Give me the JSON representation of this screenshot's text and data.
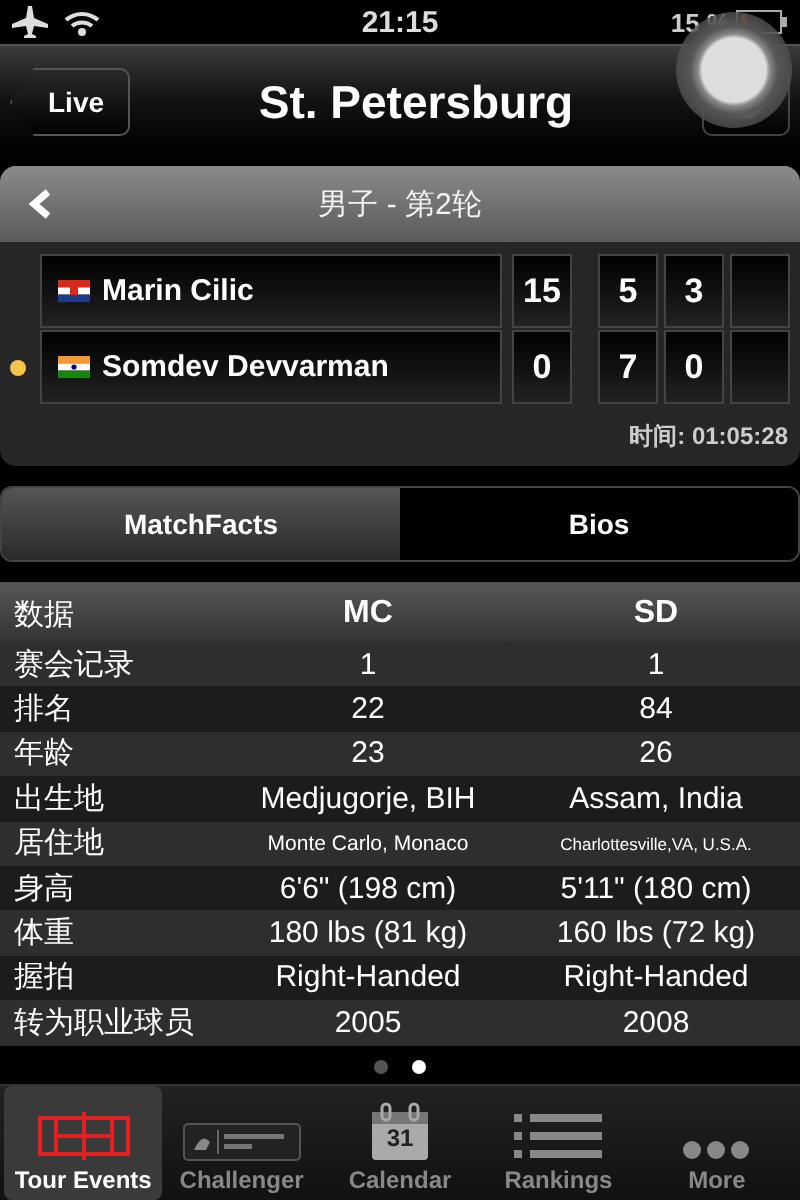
{
  "status_bar": {
    "time": "21:15",
    "battery": "15 %"
  },
  "nav_bar": {
    "back": "Live",
    "title": "St. Petersburg"
  },
  "match": {
    "round": "男子 - 第2轮",
    "players": [
      {
        "name": "Marin Cilic",
        "kind": "hr",
        "serving": false,
        "points": "15",
        "sets": [
          "5",
          "3"
        ]
      },
      {
        "name": "Somdev Devvarman",
        "kind": "in",
        "serving": true,
        "points": "0",
        "sets": [
          "7",
          "0"
        ]
      }
    ],
    "time": "时间: 01:05:28"
  },
  "tabs": [
    {
      "label": "MatchFacts",
      "selected": true
    },
    {
      "label": "Bios",
      "selected": false
    }
  ],
  "stats": {
    "columns": [
      "数据",
      "MC",
      "SD"
    ],
    "rows": [
      {
        "label": "赛会记录",
        "values": [
          "1",
          "1"
        ]
      },
      {
        "label": "排名",
        "values": [
          "22",
          "84"
        ]
      },
      {
        "label": "年龄",
        "values": [
          "23",
          "26"
        ]
      },
      {
        "label": "出生地",
        "values": [
          "Medjugorje, BIH",
          "Assam, India"
        ]
      },
      {
        "label": "居住地",
        "values": [
          "Monte Carlo, Monaco",
          "Charlottesville,VA, U.S.A."
        ]
      },
      {
        "label": "身高",
        "values": [
          "6'6\" (198 cm)",
          "5'11\" (180 cm)"
        ]
      },
      {
        "label": "体重",
        "values": [
          "180 lbs (81 kg)",
          "160 lbs (72 kg)"
        ]
      },
      {
        "label": "握拍",
        "values": [
          "Right-Handed",
          "Right-Handed"
        ]
      },
      {
        "label": "转为职业球员",
        "values": [
          "2005",
          "2008"
        ]
      }
    ]
  },
  "page_dots": [
    {
      "selected": false
    },
    {
      "selected": true
    }
  ],
  "tab_bar": [
    {
      "label": "Tour Events",
      "kind": "court",
      "selected": true
    },
    {
      "label": "Challenger",
      "kind": "challenger",
      "selected": false
    },
    {
      "label": "Calendar",
      "kind": "calendar",
      "icon_text": "31",
      "selected": false
    },
    {
      "label": "Rankings",
      "kind": "list",
      "selected": false
    },
    {
      "label": "More",
      "kind": "dots",
      "selected": false
    }
  ]
}
